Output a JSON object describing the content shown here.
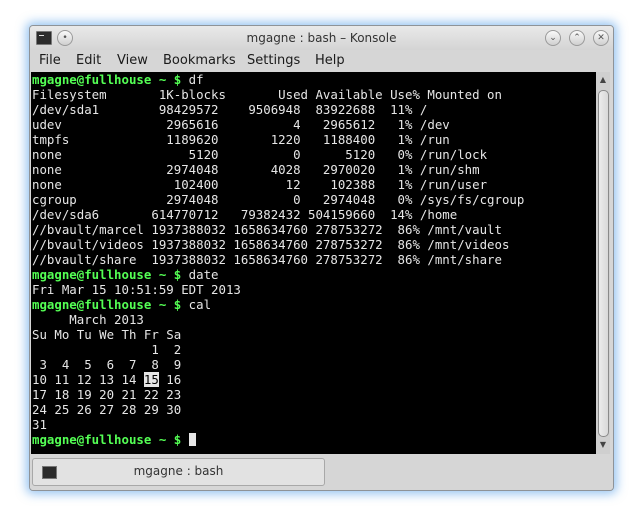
{
  "window": {
    "title": "mgagne : bash – Konsole",
    "controls": [
      "minimize-icon",
      "maximize-icon",
      "close-icon"
    ],
    "app_icon": "terminal-icon"
  },
  "menu": [
    "File",
    "Edit",
    "View",
    "Bookmarks",
    "Settings",
    "Help"
  ],
  "prompt": "mgagne@fullhouse ~ $",
  "commands": {
    "df": "df",
    "date": "date",
    "cal": "cal"
  },
  "df_output": [
    "Filesystem       1K-blocks       Used Available Use% Mounted on",
    "/dev/sda1        98429572    9506948  83922688  11% /",
    "udev              2965616          4   2965612   1% /dev",
    "tmpfs             1189620       1220   1188400   1% /run",
    "none                 5120          0      5120   0% /run/lock",
    "none              2974048       4028   2970020   1% /run/shm",
    "none               102400         12    102388   1% /run/user",
    "cgroup            2974048          0   2974048   0% /sys/fs/cgroup",
    "/dev/sda6       614770712   79382432 504159660  14% /home",
    "//bvault/marcel 1937388032 1658634760 278753272  86% /mnt/vault",
    "//bvault/videos 1937388032 1658634760 278753272  86% /mnt/videos",
    "//bvault/share  1937388032 1658634760 278753272  86% /mnt/share"
  ],
  "date_output": "Fri Mar 15 10:51:59 EDT 2013",
  "cal": {
    "header": "     March 2013",
    "weekdays": "Su Mo Tu We Th Fr Sa",
    "weeks": [
      "                1  2",
      " 3  4  5  6  7  8  9",
      "10 11 12 13 14 ",
      "17 18 19 20 21 22 23",
      "24 25 26 27 28 29 30",
      "31"
    ],
    "today": "15",
    "after_today": " 16"
  },
  "tab": {
    "label": "mgagne : bash",
    "icon": "terminal-icon"
  },
  "colors": {
    "prompt": "#54ff54",
    "terminal_bg": "#000000",
    "terminal_fg": "#e6e6e6",
    "window_glow": "#4696e6"
  }
}
